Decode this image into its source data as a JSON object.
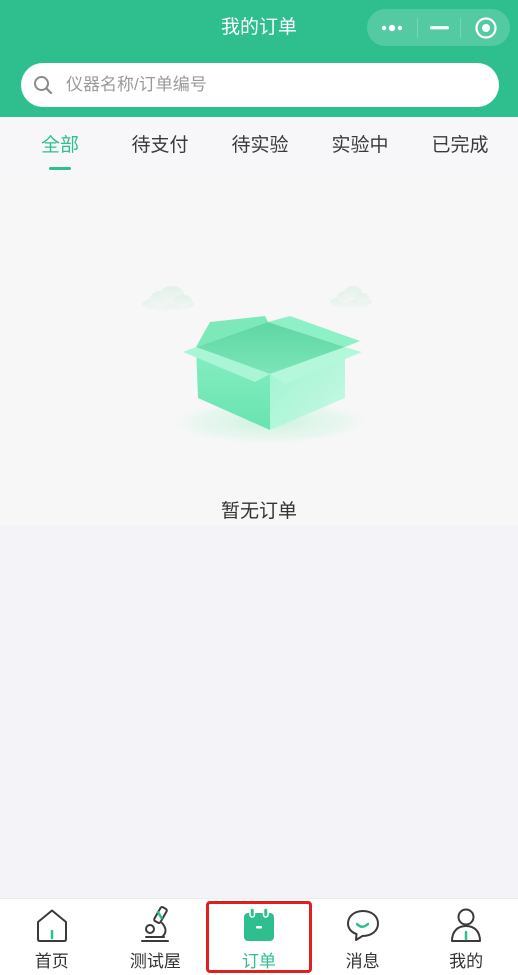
{
  "header": {
    "title": "我的订单"
  },
  "capsule": {
    "more_icon": "more-dots-icon",
    "minimize_icon": "minus-icon",
    "close_icon": "target-circle-icon"
  },
  "search": {
    "icon": "search-icon",
    "placeholder": "仪器名称/订单编号",
    "value": ""
  },
  "tabs": {
    "active_index": 0,
    "items": [
      {
        "label": "全部"
      },
      {
        "label": "待支付"
      },
      {
        "label": "待实验"
      },
      {
        "label": "实验中"
      },
      {
        "label": "已完成"
      }
    ]
  },
  "empty_state": {
    "illustration": "empty-box-icon",
    "text": "暂无订单"
  },
  "tabbar": {
    "active_index": 2,
    "items": [
      {
        "label": "首页",
        "icon": "home-icon"
      },
      {
        "label": "测试屋",
        "icon": "microscope-icon"
      },
      {
        "label": "订单",
        "icon": "calendar-icon"
      },
      {
        "label": "消息",
        "icon": "chat-bubble-icon"
      },
      {
        "label": "我的",
        "icon": "person-icon"
      }
    ]
  },
  "colors": {
    "primary": "#2FBF8F",
    "highlight": "#E02020",
    "page_background": "#F4F4F8"
  }
}
